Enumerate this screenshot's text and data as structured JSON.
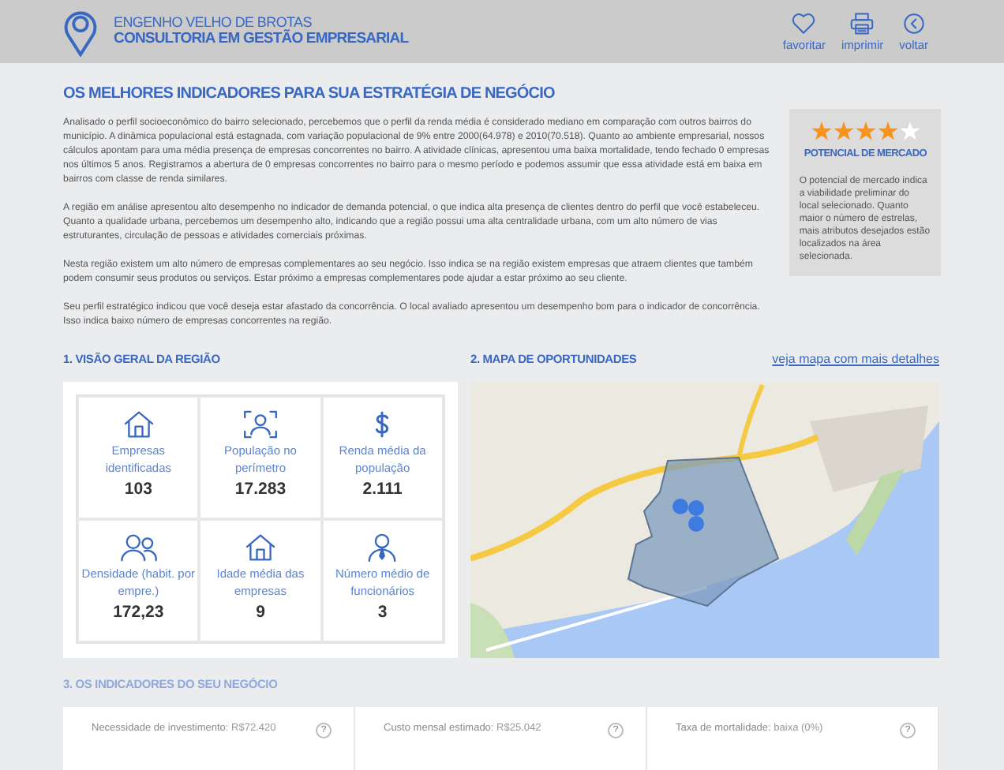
{
  "header": {
    "location": "ENGENHO VELHO DE BROTAS",
    "title": "CONSULTORIA EM GESTÃO EMPRESARIAL",
    "actions": [
      {
        "kind": "heart",
        "label": "favoritar"
      },
      {
        "kind": "print",
        "label": "imprimir"
      },
      {
        "kind": "back",
        "label": "voltar"
      }
    ]
  },
  "intro": {
    "title": "OS MELHORES INDICADORES PARA SUA ESTRATÉGIA DE NEGÓCIO",
    "paragraphs": [
      "Analisado o perfil socioeconômico do bairro selecionado, percebemos que o perfil da renda média é considerado mediano em comparação com outros bairros do município. A dinâmica populacional está estagnada, com variação populacional de 9% entre 2000(64.978) e 2010(70.518). Quanto ao ambiente empresarial, nossos cálculos apontam para uma média presença de empresas concorrentes no bairro. A atividade clínicas, apresentou uma baixa mortalidade, tendo fechado 0 empresas nos últimos 5 anos. Registramos a abertura de 0 empresas concorrentes no bairro para o mesmo período e podemos assumir que essa atividade está em baixa em bairros com classe de renda similares.",
      "A região em análise apresentou alto desempenho no indicador de demanda potencial, o que indica alta presença de clientes dentro do perfil que você estabeleceu. Quanto a qualidade urbana, percebemos um desempenho alto, indicando que a região possui uma alta centralidade urbana, com um alto número de vias estruturantes, circulação de pessoas e atividades comerciais próximas.",
      "Nesta região existem um alto número de empresas complementares ao seu negócio. Isso indica se na região existem empresas que atraem clientes que também podem consumir seus produtos ou serviços. Estar próximo a empresas complementares pode ajudar a estar próximo ao seu cliente.",
      "Seu perfil estratégico indicou que você deseja estar afastado da concorrência. O local avaliado apresentou um desempenho bom para o indicador de concorrência. Isso indica baixo número de empresas concorrentes na região."
    ]
  },
  "market": {
    "stars": 4,
    "title": "POTENCIAL DE MERCADO",
    "description": "O potencial de mercado indica a viabilidade preliminar do local selecionado. Quanto maior o número de estrelas, mais atributos desejados estão localizados na área selecionada."
  },
  "overview": {
    "title": "1. VISÃO GERAL DA REGIÃO",
    "stats": [
      {
        "kind": "house",
        "label": "Empresas identificadas",
        "value": "103"
      },
      {
        "kind": "person-frame",
        "label": "População no perímetro",
        "value": "17.283"
      },
      {
        "kind": "dollar",
        "label": "Renda média da população",
        "value": "2.111"
      },
      {
        "kind": "people",
        "label": "Densidade (habit. por empre.)",
        "value": "172,23"
      },
      {
        "kind": "house",
        "label": "Idade média das empresas",
        "value": "9"
      },
      {
        "kind": "worker",
        "label": "Número médio de funcionários",
        "value": "3"
      }
    ]
  },
  "map": {
    "title": "2. MAPA DE OPORTUNIDADES",
    "link": "veja mapa com mais detalhes",
    "kind": "picture"
  },
  "indicators": {
    "title": "3. OS INDICADORES DO SEU NEGÓCIO",
    "items": [
      {
        "label": "Necessidade de investimento:",
        "value": "R$72.420",
        "help": "?"
      },
      {
        "label": "Custo mensal estimado:",
        "value": "R$25.042",
        "help": "?"
      },
      {
        "label": "Taxa de mortalidade:",
        "value": "baixa (0%)",
        "help": "?"
      }
    ]
  }
}
